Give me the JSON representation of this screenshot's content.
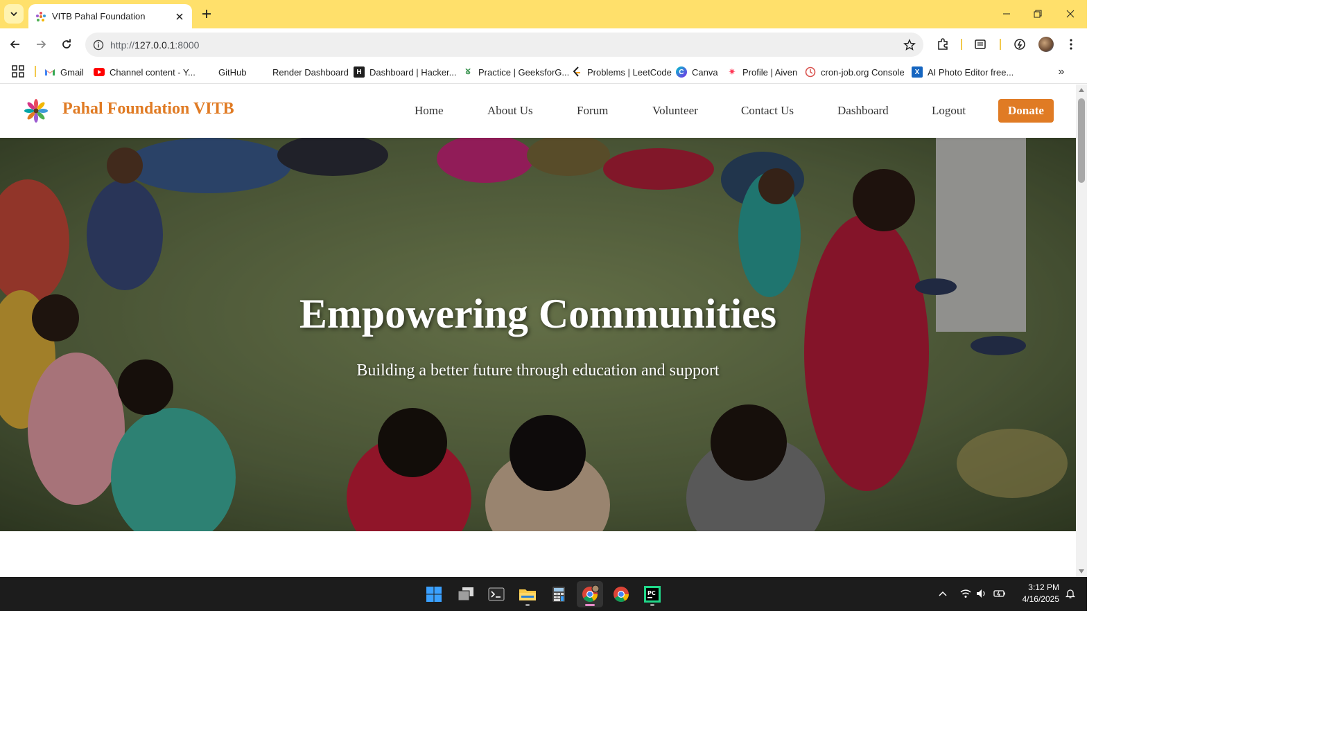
{
  "browser": {
    "tab_title": "VITB Pahal Foundation",
    "url_prefix": "http://",
    "url_host": "127.0.0.1",
    "url_port": ":8000",
    "bookmarks": [
      {
        "label": "Gmail",
        "icon": "gmail-icon"
      },
      {
        "label": "Channel content - Y...",
        "icon": "youtube-icon"
      },
      {
        "label": "GitHub",
        "icon": "github-icon"
      },
      {
        "label": "Render Dashboard",
        "icon": "render-icon"
      },
      {
        "label": "Dashboard | Hacker...",
        "icon": "hackerrank-icon"
      },
      {
        "label": "Practice | GeeksforG...",
        "icon": "geeksforgeeks-icon"
      },
      {
        "label": "Problems | LeetCode",
        "icon": "leetcode-icon"
      },
      {
        "label": "Canva",
        "icon": "canva-icon"
      },
      {
        "label": "Profile | Aiven",
        "icon": "aiven-icon"
      },
      {
        "label": "cron-job.org Console",
        "icon": "cronjob-icon"
      },
      {
        "label": "AI Photo Editor free...",
        "icon": "photo-editor-icon"
      }
    ]
  },
  "site": {
    "brand": "Pahal Foundation VITB",
    "nav": {
      "home": "Home",
      "about": "About Us",
      "forum": "Forum",
      "volunteer": "Volunteer",
      "contact": "Contact Us",
      "dashboard": "Dashboard",
      "logout": "Logout"
    },
    "donate": "Donate",
    "accent_color": "#e07b24"
  },
  "hero": {
    "title": "Empowering Communities",
    "subtitle": "Building a better future through education and support"
  },
  "taskbar": {
    "apps": [
      "start-icon",
      "task-view-icon",
      "terminal-icon",
      "file-explorer-icon",
      "calculator-icon",
      "chrome-profile-icon",
      "chrome-icon",
      "pycharm-icon"
    ],
    "time": "3:12 PM",
    "date": "4/16/2025"
  }
}
